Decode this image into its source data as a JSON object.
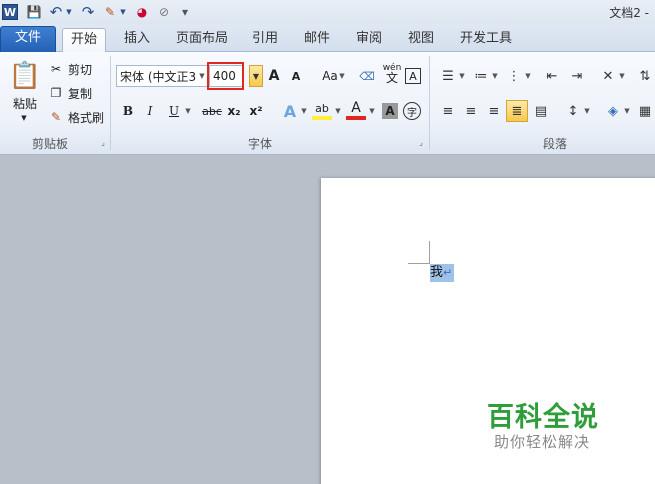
{
  "window": {
    "title": "文档2 -",
    "app_icon": "word-icon"
  },
  "quick_access": {
    "icons": [
      "save-icon",
      "undo-icon",
      "redo-icon",
      "format-painter-icon",
      "color-icon",
      "clear-icon",
      "customize-icon"
    ],
    "save_glyph": "💾",
    "undo_glyph": "↶",
    "redo_glyph": "↷",
    "paint_glyph": "✎",
    "color_glyph": "◕",
    "clear_glyph": "⊘",
    "customize_glyph": "▾"
  },
  "tabs": [
    {
      "label": "文件"
    },
    {
      "label": "开始"
    },
    {
      "label": "插入"
    },
    {
      "label": "页面布局"
    },
    {
      "label": "引用"
    },
    {
      "label": "邮件"
    },
    {
      "label": "审阅"
    },
    {
      "label": "视图"
    },
    {
      "label": "开发工具"
    }
  ],
  "clipboard": {
    "paste_label": "粘贴",
    "cut_label": "剪切",
    "copy_label": "复制",
    "format_painter_label": "格式刷",
    "group_label": "剪贴板"
  },
  "font": {
    "font_name": "宋体 (中文正3",
    "font_size": "400",
    "group_label": "字体",
    "grow_label": "A",
    "shrink_label": "A",
    "case_label": "Aa",
    "bold_label": "B",
    "italic_label": "I",
    "underline_label": "U",
    "strike_label": "abc",
    "subscript_label": "x₂",
    "superscript_label": "x²",
    "effects_label": "A",
    "highlight_label": "ab",
    "font_color_label": "A",
    "shading_label": "A",
    "enclose_label": "字",
    "phonetic_label": "wén",
    "phonetic_char": "文",
    "border_label": "A"
  },
  "paragraph": {
    "group_label": "段落"
  },
  "document": {
    "text": "我",
    "pilcrow": "↵"
  },
  "watermark": {
    "main": "百科全说",
    "sub": "助你轻松解决"
  },
  "colors": {
    "accent": "#2b5797",
    "highlight_border": "#e0281f",
    "selection": "#9fc3e8",
    "watermark": "#2e9e3a"
  }
}
